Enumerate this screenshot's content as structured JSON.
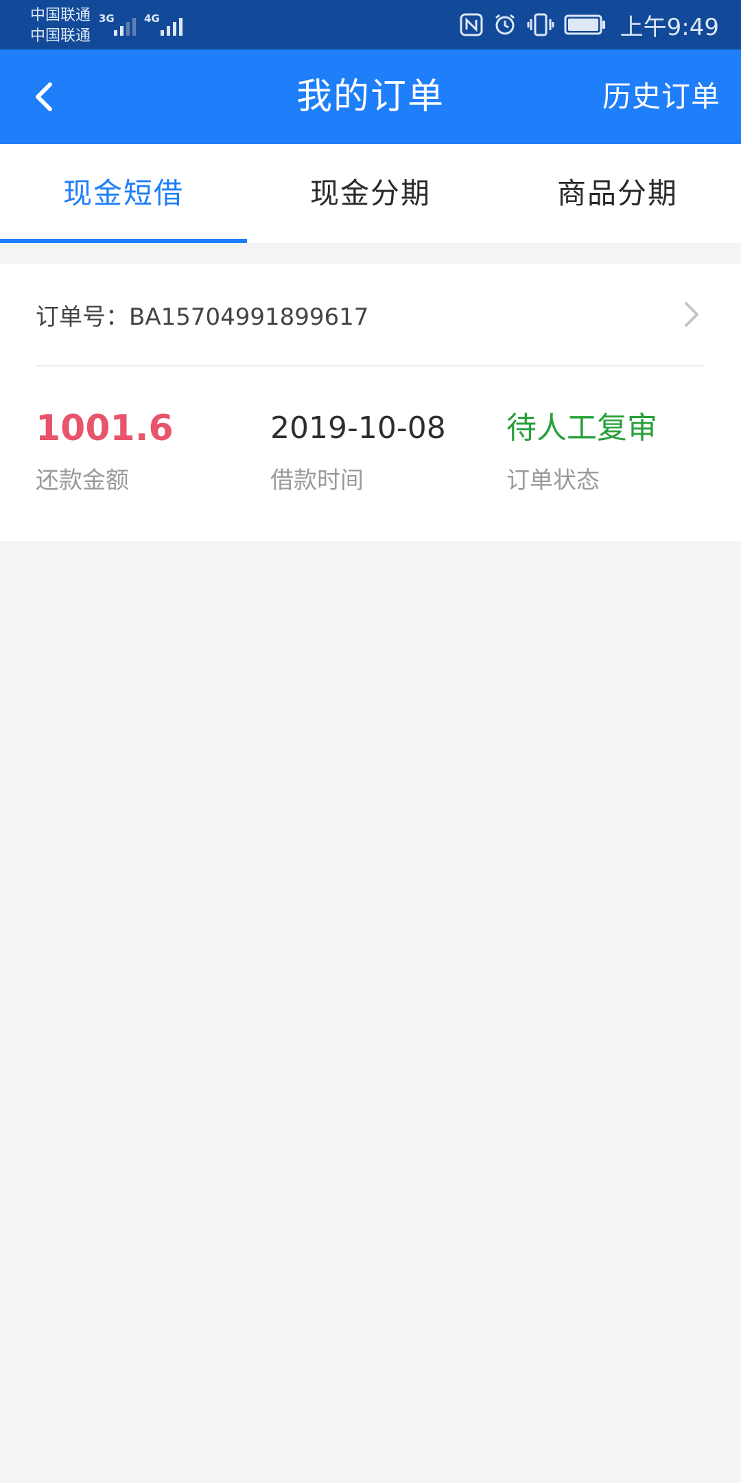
{
  "status_bar": {
    "carrier_1": "中国联通",
    "carrier_2": "中国联通",
    "network_1": "3G",
    "network_2": "4G",
    "time": "上午9:49",
    "icons": [
      "nfc-icon",
      "alarm-icon",
      "vibrate-icon",
      "battery-icon"
    ]
  },
  "app_bar": {
    "title": "我的订单",
    "history_label": "历史订单",
    "back_icon": "chevron-left-icon"
  },
  "tabs": [
    {
      "label": "现金短借",
      "active": true
    },
    {
      "label": "现金分期",
      "active": false
    },
    {
      "label": "商品分期",
      "active": false
    }
  ],
  "order": {
    "number_label": "订单号：",
    "number": "BA15704991899617",
    "amount": "1001.6",
    "amount_label": "还款金额",
    "date": "2019-10-08",
    "date_label": "借款时间",
    "status": "待人工复审",
    "status_label": "订单状态"
  },
  "colors": {
    "status_bar": "#124a99",
    "primary": "#1f7ef9",
    "amount": "#e8546b",
    "status": "#27a03a",
    "background": "#f4f4f4"
  }
}
